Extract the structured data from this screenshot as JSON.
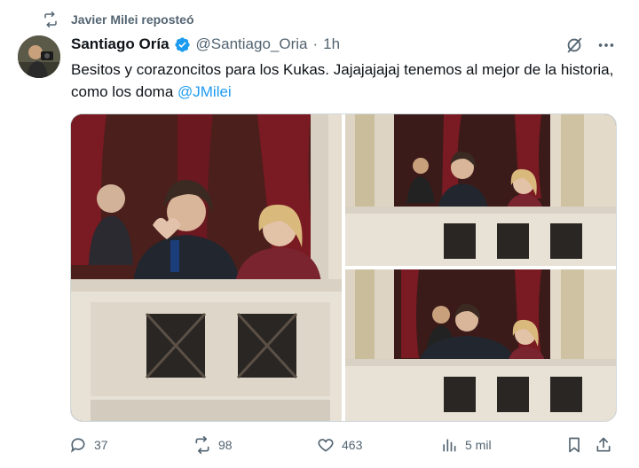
{
  "repost": {
    "label": "Javier Milei reposteó",
    "icon": "repost-icon"
  },
  "author": {
    "name": "Santiago Oría",
    "handle": "@Santiago_Oria",
    "separator": "·",
    "time": "1h",
    "verified_color": "#1d9bf0"
  },
  "tweet": {
    "text": "Besitos y corazoncitos para los Kukas. Jajajajajaj tenemos al mejor de la historia, como los doma ",
    "mention": "@JMilei"
  },
  "colors": {
    "link": "#1d9bf0",
    "secondary": "#536471",
    "curtain": "#7a1a22",
    "balcony": "#e8e2d6"
  },
  "actions": {
    "replies": "37",
    "reposts": "98",
    "likes": "463",
    "views": "5 mil"
  },
  "media": {
    "count": 3
  }
}
